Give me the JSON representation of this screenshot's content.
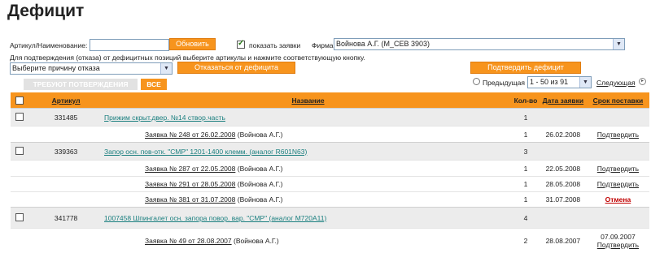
{
  "page_title": "Дефицит",
  "filter": {
    "article_label": "Артикул/Наименование:",
    "article_value": "",
    "refresh_label": "Обновить",
    "show_requests_label": "показать заявки",
    "show_requests_checked": true,
    "firm_label": "Фирма:",
    "firm_value": "Войнова А.Г. (М_СЕВ 3903)"
  },
  "instruction": "Для подтверждения (отказа) от дефицитных позиций выберите артикулы и нажмите соответствующую кнопку.",
  "reason_select": "Выберите причину отказа",
  "refuse_label": "Отказаться от дефицита",
  "confirm_label": "Подтвердить дефицит",
  "tabs": {
    "pending": "ТРЕБУЮТ ПОТВЕРЖДЕНИЯ",
    "all": "ВСЕ"
  },
  "pager": {
    "prev": "Предыдущая",
    "range": "1 - 50 из 91",
    "next": "Следующая"
  },
  "table": {
    "headers": {
      "article": "Артикул",
      "name": "Название",
      "qty": "Кол-во",
      "date": "Дата заявки",
      "term": "Срок поставки"
    },
    "rows": [
      {
        "article": "331485",
        "name": "Прижим скрыт.двер. №14 створ.часть",
        "qty": "1"
      },
      {
        "order": "Заявка № 248 от 26.02.2008",
        "person": "(Войнова А.Г.)",
        "qty": "1",
        "date": "26.02.2008",
        "term": "Подтвердить"
      },
      {
        "article": "339363",
        "name": "Запор осн. пов-отк. \"СМР\" 1201-1400 клемм. (аналог R601N63)",
        "qty": "3"
      },
      {
        "order": "Заявка № 287 от 22.05.2008",
        "person": "(Войнова А.Г.)",
        "qty": "1",
        "date": "22.05.2008",
        "term": "Подтвердить"
      },
      {
        "order": "Заявка № 291 от 28.05.2008",
        "person": "(Войнова А.Г.)",
        "qty": "1",
        "date": "28.05.2008",
        "term": "Подтвердить"
      },
      {
        "order": "Заявка № 381 от 31.07.2008",
        "person": "(Войнова А.Г.)",
        "qty": "1",
        "date": "31.07.2008",
        "term": "Отмена"
      },
      {
        "article": "341778",
        "name": "1007458 Шпингалет осн. запора повор. вар. \"СМР\" (аналог M720A11)",
        "qty": "4"
      },
      {
        "order": "Заявка № 49 от 28.08.2007",
        "person": "(Войнова А.Г.)",
        "qty": "2",
        "date": "28.08.2007",
        "term": "07.09.2007",
        "term2": "Подтвердить"
      }
    ]
  },
  "colors": {
    "accent": "#f7941d",
    "link": "#1a7f7f",
    "cancel": "#c00000"
  }
}
